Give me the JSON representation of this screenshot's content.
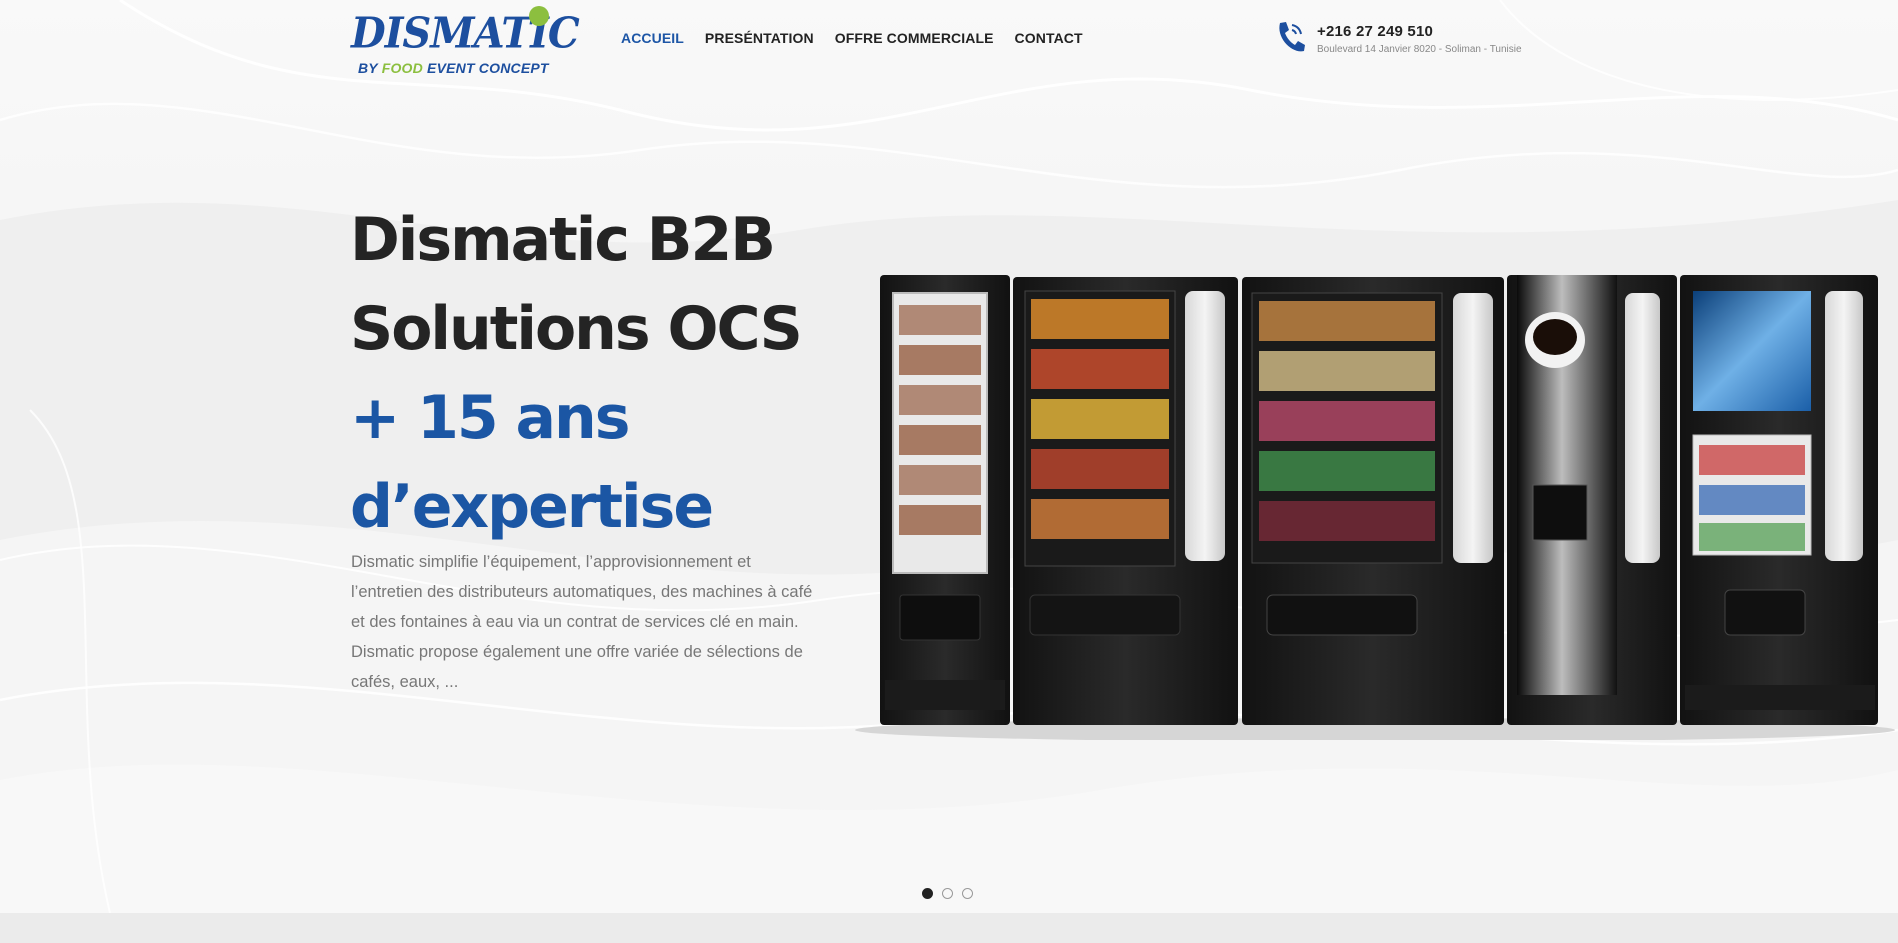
{
  "brand": {
    "logo_main": "DISMATIC",
    "logo_sub_by": "BY",
    "logo_sub_food": "FOOD",
    "logo_sub_rest": "EVENT CONCEPT",
    "primary_color": "#1d4f9f",
    "accent_color": "#8cbf3f"
  },
  "nav": {
    "items": [
      {
        "label": "ACCUEIL",
        "active": true
      },
      {
        "label": "PRESÉNTATION",
        "active": false
      },
      {
        "label": "OFFRE COMMERCIALE",
        "active": false
      },
      {
        "label": "CONTACT",
        "active": false
      }
    ]
  },
  "contact": {
    "icon": "phone-icon",
    "phone": "+216 27 249 510",
    "address": "Boulevard 14 Janvier 8020 - Soliman - Tunisie"
  },
  "hero": {
    "title_line1": "Dismatic B2B",
    "title_line2": "Solutions OCS",
    "highlight_line1": "+ 15 ans",
    "highlight_line2": "d’expertise",
    "description": "Dismatic simplifie l’équipement, l’approvisionnement et l’entretien des distributeurs automatiques, des machines à café et des fontaines à eau via un contrat de services clé en main. Dismatic propose également une offre variée de sélections de cafés, eaux, ...",
    "image": "vending-machines-image"
  },
  "slider": {
    "slide_count": 3,
    "active_index": 0
  }
}
